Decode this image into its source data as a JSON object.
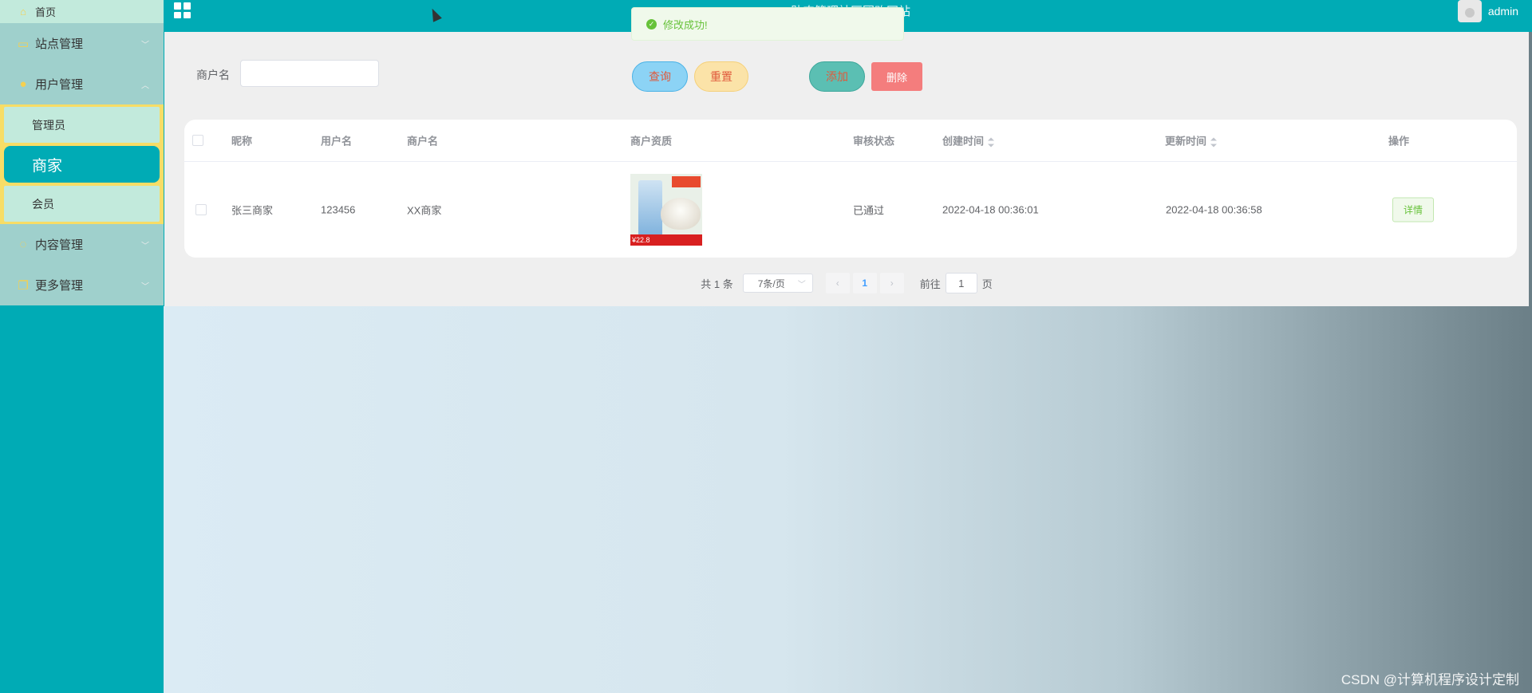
{
  "sidebar": {
    "home": "首页",
    "items": [
      {
        "label": "站点管理",
        "icon": "site-icon"
      },
      {
        "label": "用户管理",
        "icon": "user-icon"
      }
    ],
    "sub_items": [
      "管理员",
      "商家",
      "会员"
    ],
    "items_bottom": [
      {
        "label": "内容管理",
        "icon": "content-icon"
      },
      {
        "label": "更多管理",
        "icon": "more-icon"
      }
    ]
  },
  "header": {
    "title": "助农管理社区团购网站",
    "user": "admin"
  },
  "toast": {
    "message": "修改成功!"
  },
  "search": {
    "label": "商户名",
    "value": "",
    "query_button": "查询",
    "reset_button": "重置",
    "add_button": "添加",
    "delete_button": "删除"
  },
  "table": {
    "columns": [
      "昵称",
      "用户名",
      "商户名",
      "商户资质",
      "审核状态",
      "创建时间",
      "更新时间",
      "操作"
    ],
    "rows": [
      {
        "nickname": "张三商家",
        "username": "123456",
        "merchant": "XX商家",
        "qualification_image": "rice-product-image",
        "image_price": "¥22.8",
        "status": "已通过",
        "created": "2022-04-18 00:36:01",
        "updated": "2022-04-18 00:36:58",
        "action": "详情"
      }
    ]
  },
  "pagination": {
    "total": "共 1 条",
    "page_size": "7条/页",
    "current_page": "1",
    "goto_label": "前往",
    "goto_value": "1",
    "page_unit": "页"
  },
  "watermark": "CSDN @计算机程序设计定制",
  "colors": {
    "primary": "#00abb5",
    "sidebar_bg": "#9fd0cc",
    "submenu_border": "#f7dd66",
    "success": "#67c23a"
  }
}
